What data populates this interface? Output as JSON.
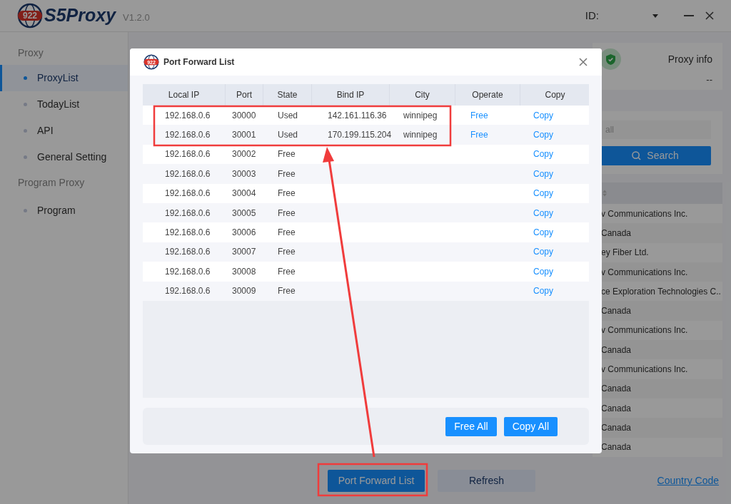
{
  "app": {
    "logo_text": "922",
    "brand": "S5Proxy",
    "version": "V1.2.0",
    "id_label": "ID:"
  },
  "sidebar": {
    "sections": [
      {
        "title": "Proxy",
        "items": [
          {
            "label": "ProxyList",
            "selected": true
          },
          {
            "label": "TodayList",
            "selected": false
          },
          {
            "label": "API",
            "selected": false
          },
          {
            "label": "General Setting",
            "selected": false
          }
        ]
      },
      {
        "title": "Program Proxy",
        "items": [
          {
            "label": "Program",
            "selected": false
          }
        ]
      }
    ]
  },
  "proxy_info": {
    "title": "Proxy info",
    "value": "--"
  },
  "search": {
    "placeholder": "all",
    "button": "Search"
  },
  "isp_list": {
    "rows": [
      "v Communications Inc.",
      "Canada",
      "ey Fiber Ltd.",
      "v Communications Inc.",
      "ce Exploration Technologies C..",
      "Canada",
      "v Communications Inc.",
      "Canada",
      "v Communications Inc.",
      "Canada",
      "Canada",
      "Canada",
      "Canada"
    ]
  },
  "bottom_bar": {
    "buttons": [
      {
        "label": "Port Forward List",
        "kind": "primary"
      },
      {
        "label": "Refresh",
        "kind": "secondary"
      }
    ],
    "link": "Country Code"
  },
  "dialog": {
    "logo_text": "922",
    "title": "Port Forward List",
    "columns": [
      "Local IP",
      "Port",
      "State",
      "Bind IP",
      "City",
      "Operate",
      "Copy"
    ],
    "rows": [
      {
        "local_ip": "192.168.0.6",
        "port": "30000",
        "state": "Used",
        "bind_ip": "142.161.116.36",
        "city": "winnipeg",
        "operate": "Free",
        "copy": "Copy"
      },
      {
        "local_ip": "192.168.0.6",
        "port": "30001",
        "state": "Used",
        "bind_ip": "170.199.115.204",
        "city": "winnipeg",
        "operate": "Free",
        "copy": "Copy"
      },
      {
        "local_ip": "192.168.0.6",
        "port": "30002",
        "state": "Free",
        "copy": "Copy"
      },
      {
        "local_ip": "192.168.0.6",
        "port": "30003",
        "state": "Free",
        "copy": "Copy"
      },
      {
        "local_ip": "192.168.0.6",
        "port": "30004",
        "state": "Free",
        "copy": "Copy"
      },
      {
        "local_ip": "192.168.0.6",
        "port": "30005",
        "state": "Free",
        "copy": "Copy"
      },
      {
        "local_ip": "192.168.0.6",
        "port": "30006",
        "state": "Free",
        "copy": "Copy"
      },
      {
        "local_ip": "192.168.0.6",
        "port": "30007",
        "state": "Free",
        "copy": "Copy"
      },
      {
        "local_ip": "192.168.0.6",
        "port": "30008",
        "state": "Free",
        "copy": "Copy"
      },
      {
        "local_ip": "192.168.0.6",
        "port": "30009",
        "state": "Free",
        "copy": "Copy"
      }
    ],
    "buttons": [
      "Free All",
      "Copy All"
    ]
  }
}
